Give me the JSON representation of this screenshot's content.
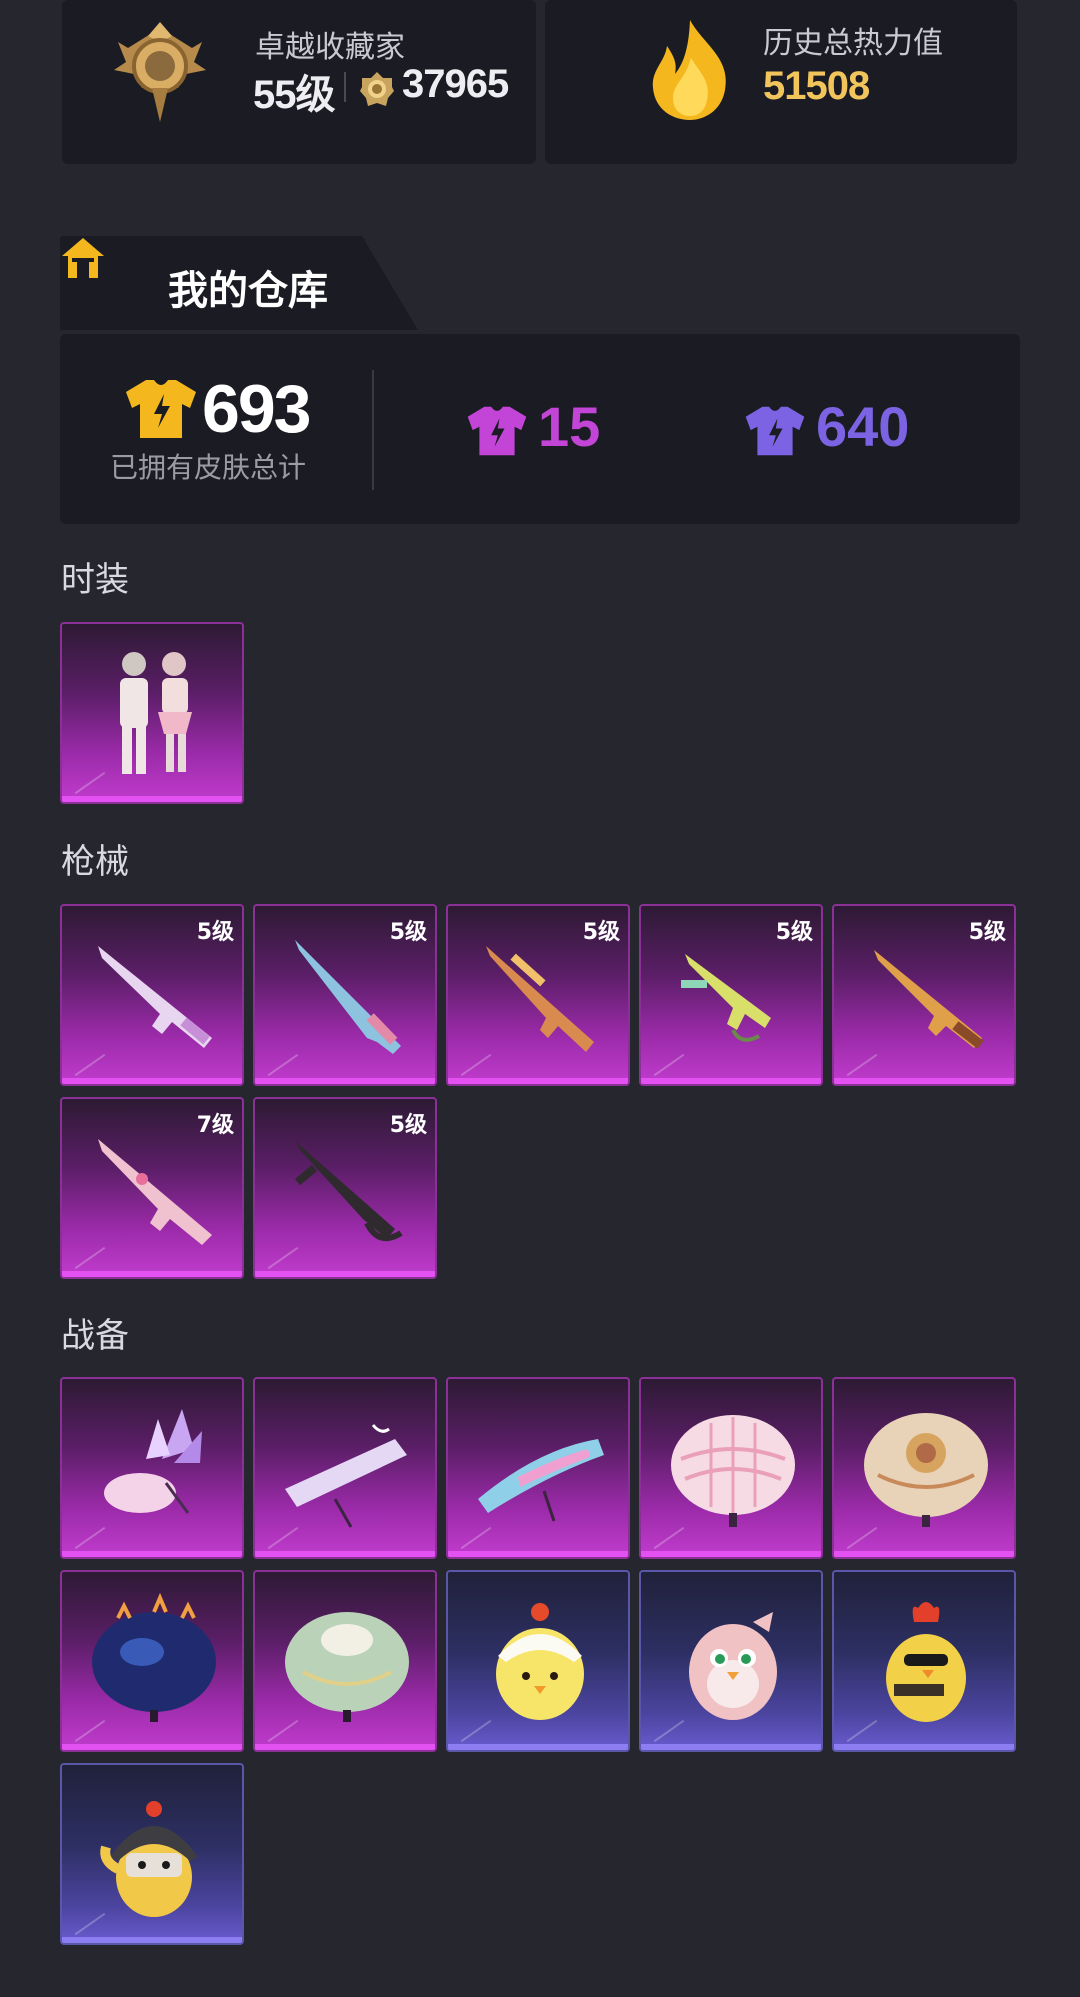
{
  "profile": {
    "rank_name": "卓越收藏家",
    "level": "55级",
    "points": "37965",
    "heat_label": "历史总热力值",
    "heat_value": "51508"
  },
  "warehouse": {
    "title": "我的仓库",
    "total_count": "693",
    "total_label": "已拥有皮肤总计",
    "purple_count": "15",
    "blue_count": "640"
  },
  "colors": {
    "background": "#26262e",
    "panel": "#1b1c23",
    "gold": "#f2c45c",
    "purple_rarity": "#c245d7",
    "blue_rarity": "#7b63e3"
  },
  "sections": {
    "fashion": {
      "title": "时装",
      "items": [
        {
          "name": "couple-outfit",
          "rarity": "purple"
        }
      ]
    },
    "weapons": {
      "title": "枪械",
      "items": [
        {
          "name": "rifle-skin-1",
          "level": "5级",
          "rarity": "purple"
        },
        {
          "name": "rifle-skin-2",
          "level": "5级",
          "rarity": "purple"
        },
        {
          "name": "rifle-skin-3",
          "level": "5级",
          "rarity": "purple"
        },
        {
          "name": "smg-skin",
          "level": "5级",
          "rarity": "purple"
        },
        {
          "name": "rifle-skin-4",
          "level": "5级",
          "rarity": "purple"
        },
        {
          "name": "rifle-skin-5",
          "level": "7级",
          "rarity": "purple"
        },
        {
          "name": "rifle-skin-6",
          "level": "5级",
          "rarity": "purple"
        }
      ]
    },
    "gear": {
      "title": "战备",
      "items": [
        {
          "name": "crystal-glider",
          "rarity": "purple"
        },
        {
          "name": "lavender-glider",
          "rarity": "purple"
        },
        {
          "name": "pastel-glider",
          "rarity": "purple"
        },
        {
          "name": "pink-plaid-parachute",
          "rarity": "purple"
        },
        {
          "name": "ornate-parachute",
          "rarity": "purple"
        },
        {
          "name": "blue-flame-parachute",
          "rarity": "purple"
        },
        {
          "name": "mint-parachute",
          "rarity": "purple"
        },
        {
          "name": "chick-companion",
          "rarity": "blue"
        },
        {
          "name": "pink-bird-companion",
          "rarity": "blue"
        },
        {
          "name": "rooster-companion",
          "rarity": "blue"
        },
        {
          "name": "helmet-chick-companion",
          "rarity": "blue"
        }
      ]
    }
  }
}
